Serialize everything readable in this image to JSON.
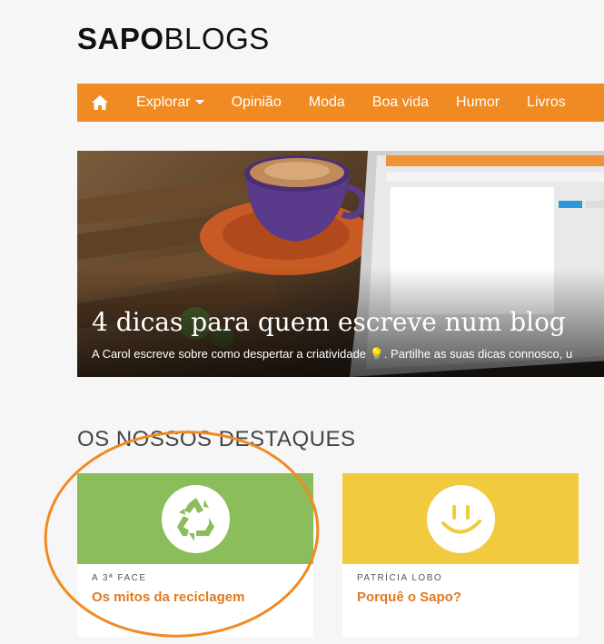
{
  "logo": {
    "bold": "SAPO",
    "light": "BLOGS"
  },
  "nav": {
    "home_icon": "home-icon",
    "items": [
      {
        "label": "Explorar",
        "has_caret": true
      },
      {
        "label": "Opinião"
      },
      {
        "label": "Moda"
      },
      {
        "label": "Boa vida"
      },
      {
        "label": "Humor"
      },
      {
        "label": "Livros"
      }
    ]
  },
  "hero": {
    "title": "4 dicas para quem escreve num blog",
    "subtitle": "A Carol escreve sobre como despertar a criatividade 💡. Partilhe as suas dicas connosco, u"
  },
  "section": {
    "title": "OS NOSSOS DESTAQUES"
  },
  "cards": [
    {
      "author": "A 3ª FACE",
      "title": "Os mitos da reciclagem",
      "color": "#8bbd5a",
      "icon": "recycle-icon"
    },
    {
      "author": "PATRÍCIA LOBO",
      "title": "Porquê o Sapo?",
      "color": "#f2ca3d",
      "icon": "smiley-icon"
    }
  ],
  "colors": {
    "nav": "#f08a22",
    "accent_text": "#e07a22",
    "annotation": "#f08a22"
  }
}
